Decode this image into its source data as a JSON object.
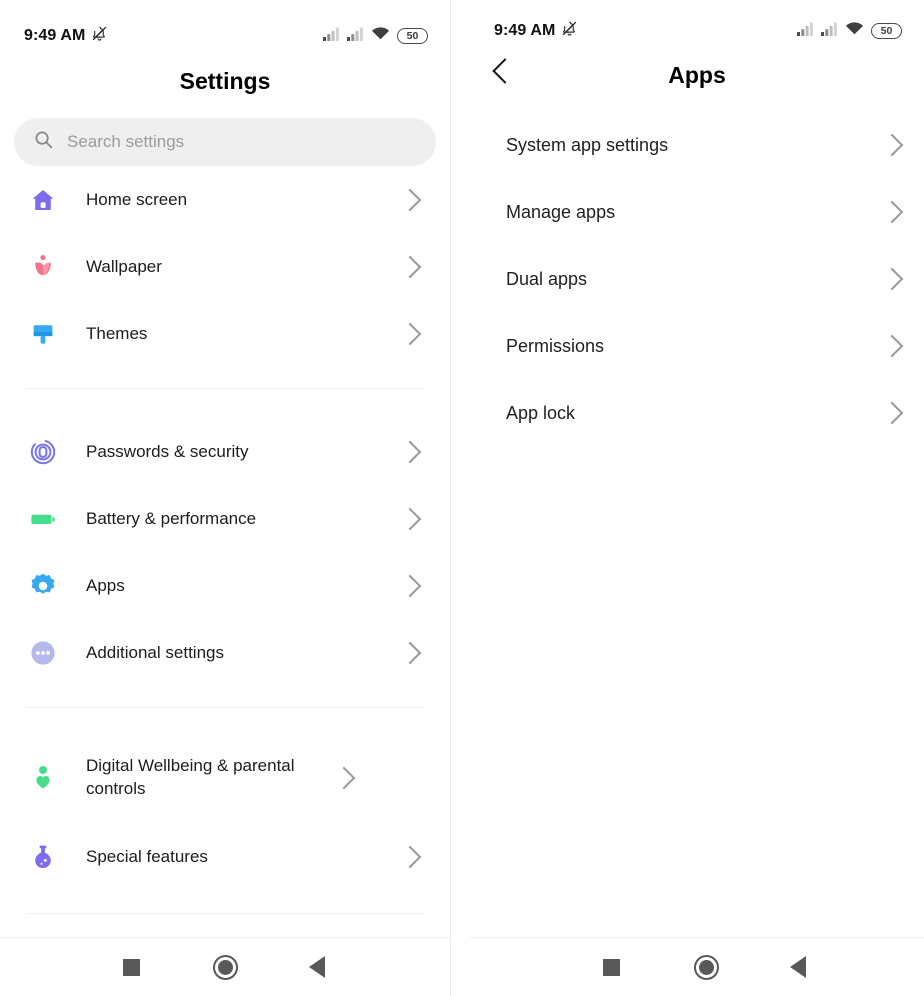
{
  "status_bar": {
    "time": "9:49 AM",
    "mute_icon": "notifications-muted-icon",
    "signal1_icon": "cellular-signal-icon",
    "signal2_icon": "cellular-signal-icon",
    "wifi_icon": "wifi-icon",
    "battery_level": "50"
  },
  "left_screen": {
    "title": "Settings",
    "search": {
      "placeholder": "Search settings",
      "value": "",
      "icon": "search-icon"
    },
    "groups": [
      {
        "items": [
          {
            "label": "Home screen",
            "icon": "home-icon",
            "color": "#7b6cf0"
          },
          {
            "label": "Wallpaper",
            "icon": "tulip-flower-icon",
            "color": "#f4738d"
          },
          {
            "label": "Themes",
            "icon": "paint-brush-icon",
            "color": "#38a8f0"
          }
        ]
      },
      {
        "items": [
          {
            "label": "Passwords & security",
            "icon": "fingerprint-icon",
            "color": "#7b73f5"
          },
          {
            "label": "Battery & performance",
            "icon": "battery-icon",
            "color": "#44dd8a"
          },
          {
            "label": "Apps",
            "icon": "gear-icon",
            "color": "#38a8f0"
          },
          {
            "label": "Additional settings",
            "icon": "more-dots-icon",
            "color": "#b4b8ea"
          }
        ]
      },
      {
        "items": [
          {
            "label": "Digital Wellbeing & parental controls",
            "icon": "wellbeing-person-heart-icon",
            "color": "#44dd8a"
          },
          {
            "label": "Special features",
            "icon": "flask-potion-icon",
            "color": "#7b6cf0"
          }
        ]
      }
    ],
    "chevron_icon": "chevron-right-icon"
  },
  "right_screen": {
    "title": "Apps",
    "back_icon": "chevron-left-icon",
    "items": [
      {
        "label": "System app settings"
      },
      {
        "label": "Manage apps"
      },
      {
        "label": "Dual apps"
      },
      {
        "label": "Permissions"
      },
      {
        "label": "App lock"
      }
    ],
    "chevron_icon": "chevron-right-icon"
  },
  "nav_bar": {
    "recents_icon": "square-recents-icon",
    "home_icon": "circle-home-icon",
    "back_icon": "triangle-back-icon"
  }
}
